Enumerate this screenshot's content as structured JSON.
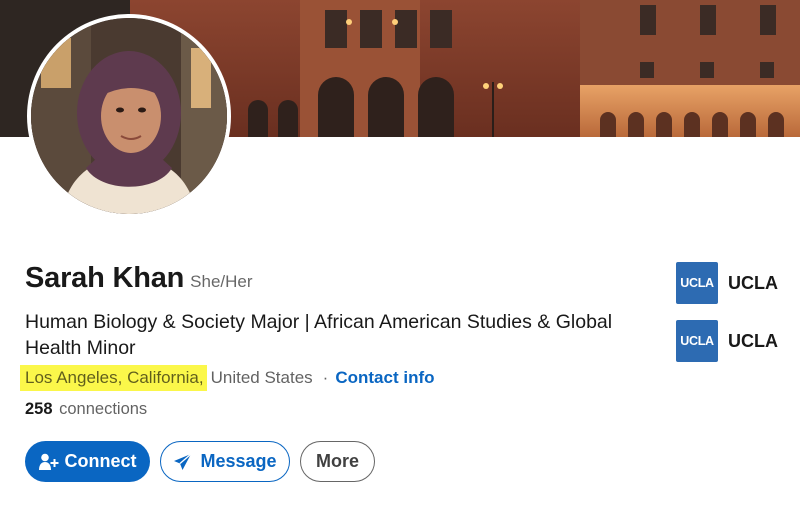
{
  "profile": {
    "name": "Sarah Khan",
    "pronouns": "She/Her",
    "headline": "Human Biology & Society Major | African American Studies & Global Health Minor",
    "location_highlighted": "Los Angeles, California,",
    "location_rest": "United States",
    "separator": "·",
    "contact_info_label": "Contact info",
    "connections_count": "258",
    "connections_label": "connections"
  },
  "actions": {
    "connect_label": "Connect",
    "message_label": "Message",
    "more_label": "More"
  },
  "education": [
    {
      "logo_text": "UCLA",
      "name": "UCLA"
    },
    {
      "logo_text": "UCLA",
      "name": "UCLA"
    }
  ],
  "icons": {
    "connect": "add-person-icon",
    "message": "send-icon"
  },
  "colors": {
    "brand_blue": "#0a66c2",
    "highlight": "#fbf74a",
    "ucla_logo": "#2d6bb2"
  }
}
